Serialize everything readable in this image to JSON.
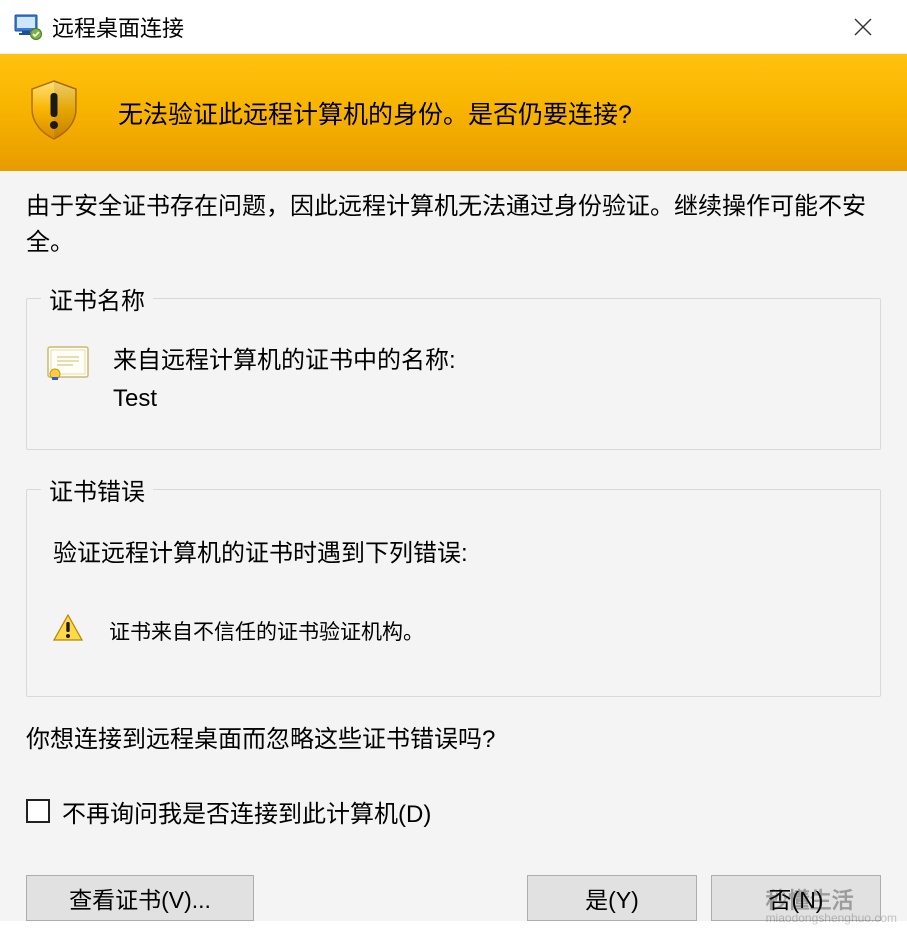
{
  "titlebar": {
    "title": "远程桌面连接"
  },
  "banner": {
    "heading": "无法验证此远程计算机的身份。是否仍要连接?"
  },
  "content": {
    "description": "由于安全证书存在问题，因此远程计算机无法通过身份验证。继续操作可能不安全。",
    "cert_name_group": {
      "legend": "证书名称",
      "label": "来自远程计算机的证书中的名称:",
      "value": "Test"
    },
    "cert_error_group": {
      "legend": "证书错误",
      "intro": "验证远程计算机的证书时遇到下列错误:",
      "error_text": "证书来自不信任的证书验证机构。"
    },
    "prompt": "你想连接到远程桌面而忽略这些证书错误吗?",
    "checkbox_label": "不再询问我是否连接到此计算机(D)"
  },
  "buttons": {
    "view_cert": "查看证书(V)...",
    "yes": "是(Y)",
    "no": "否(N)"
  },
  "watermark": {
    "main": "秒懂生活",
    "sub": "miaodongshenghuo.com"
  }
}
